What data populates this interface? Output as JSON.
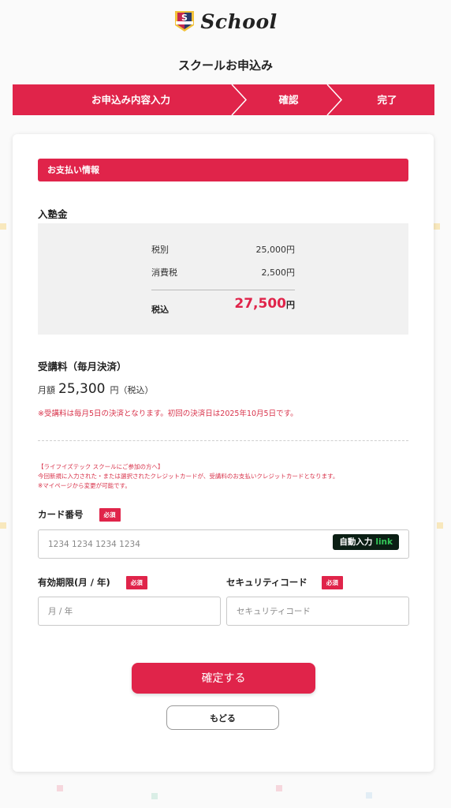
{
  "brand": {
    "logo_text": "School",
    "badge_letter": "S"
  },
  "page_title": "スクールお申込み",
  "steps": [
    {
      "label": "お申込み内容入力"
    },
    {
      "label": "確認"
    },
    {
      "label": "完了"
    }
  ],
  "payment": {
    "section_title": "お支払い情報",
    "enrollment": {
      "title": "入塾金",
      "rows": [
        {
          "label": "税別",
          "value": "25,000円"
        },
        {
          "label": "消費税",
          "value": "2,500円"
        }
      ],
      "total_label": "税込",
      "total_value": "27,500",
      "total_unit": "円"
    },
    "tuition": {
      "title": "受講料（毎月決済）",
      "monthly_label": "月額",
      "monthly_amount": "25,300",
      "monthly_unit": "円（税込）",
      "note": "※受講料は毎月5日の決済となります。初回の決済日は2025年10月5日です。"
    },
    "info_lines": [
      "【ライフイズテック スクールにご参加の方へ】",
      "今回新規に入力された・または選択されたクレジットカードが、受講料のお支払いクレジットカードとなります。",
      "※マイページから変更が可能です。"
    ]
  },
  "form": {
    "required_label": "必須",
    "card_number": {
      "label": "カード番号",
      "placeholder": "1234 1234 1234 1234"
    },
    "autofill": {
      "label": "自動入力",
      "link": "link"
    },
    "expiry": {
      "label": "有効期限(月 / 年)",
      "placeholder": "月 / 年"
    },
    "security": {
      "label": "セキュリティコード",
      "placeholder": "セキュリティコード"
    }
  },
  "actions": {
    "confirm": "確定する",
    "back": "もどる"
  },
  "colors": {
    "accent": "#e0244a",
    "link_green": "#34c759"
  }
}
